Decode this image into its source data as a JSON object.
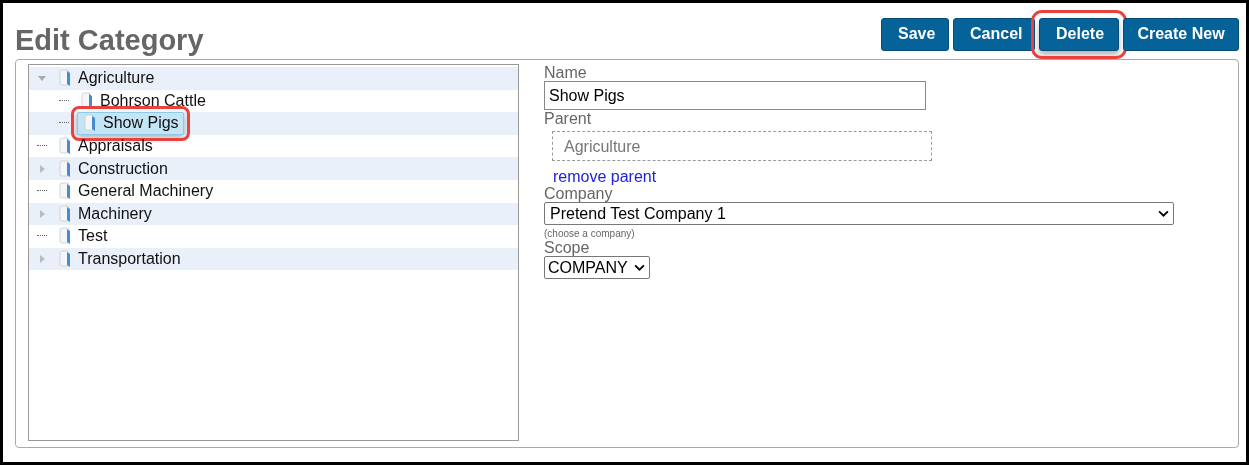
{
  "title": "Edit Category",
  "buttons": [
    {
      "label": "Save",
      "highlighted": false
    },
    {
      "label": "Cancel",
      "highlighted": false
    },
    {
      "label": "Delete",
      "highlighted": true
    },
    {
      "label": "Create New",
      "highlighted": false
    }
  ],
  "tree": [
    {
      "label": "Agriculture",
      "expanded": true,
      "selected": false,
      "highlighted": false,
      "children": [
        {
          "label": "Bohrson Cattle",
          "selected": false,
          "highlighted": false
        },
        {
          "label": "Show Pigs",
          "selected": true,
          "highlighted": true
        }
      ]
    },
    {
      "label": "Appraisals",
      "selected": false,
      "highlighted": false
    },
    {
      "label": "Construction",
      "expanded": false,
      "selected": false,
      "highlighted": false
    },
    {
      "label": "General Machinery",
      "selected": false,
      "highlighted": false
    },
    {
      "label": "Machinery",
      "expanded": false,
      "selected": false,
      "highlighted": false
    },
    {
      "label": "Test",
      "selected": false,
      "highlighted": false
    },
    {
      "label": "Transportation",
      "expanded": false,
      "selected": false,
      "highlighted": false
    }
  ],
  "form": {
    "name_label": "Name",
    "name_value": "Show Pigs",
    "parent_label": "Parent",
    "parent_value": "Agriculture",
    "remove_parent_link": "remove parent",
    "company_label": "Company",
    "company_value": "Pretend Test Company 1",
    "company_hint": "(choose a company)",
    "scope_label": "Scope",
    "scope_value": "COMPANY"
  }
}
